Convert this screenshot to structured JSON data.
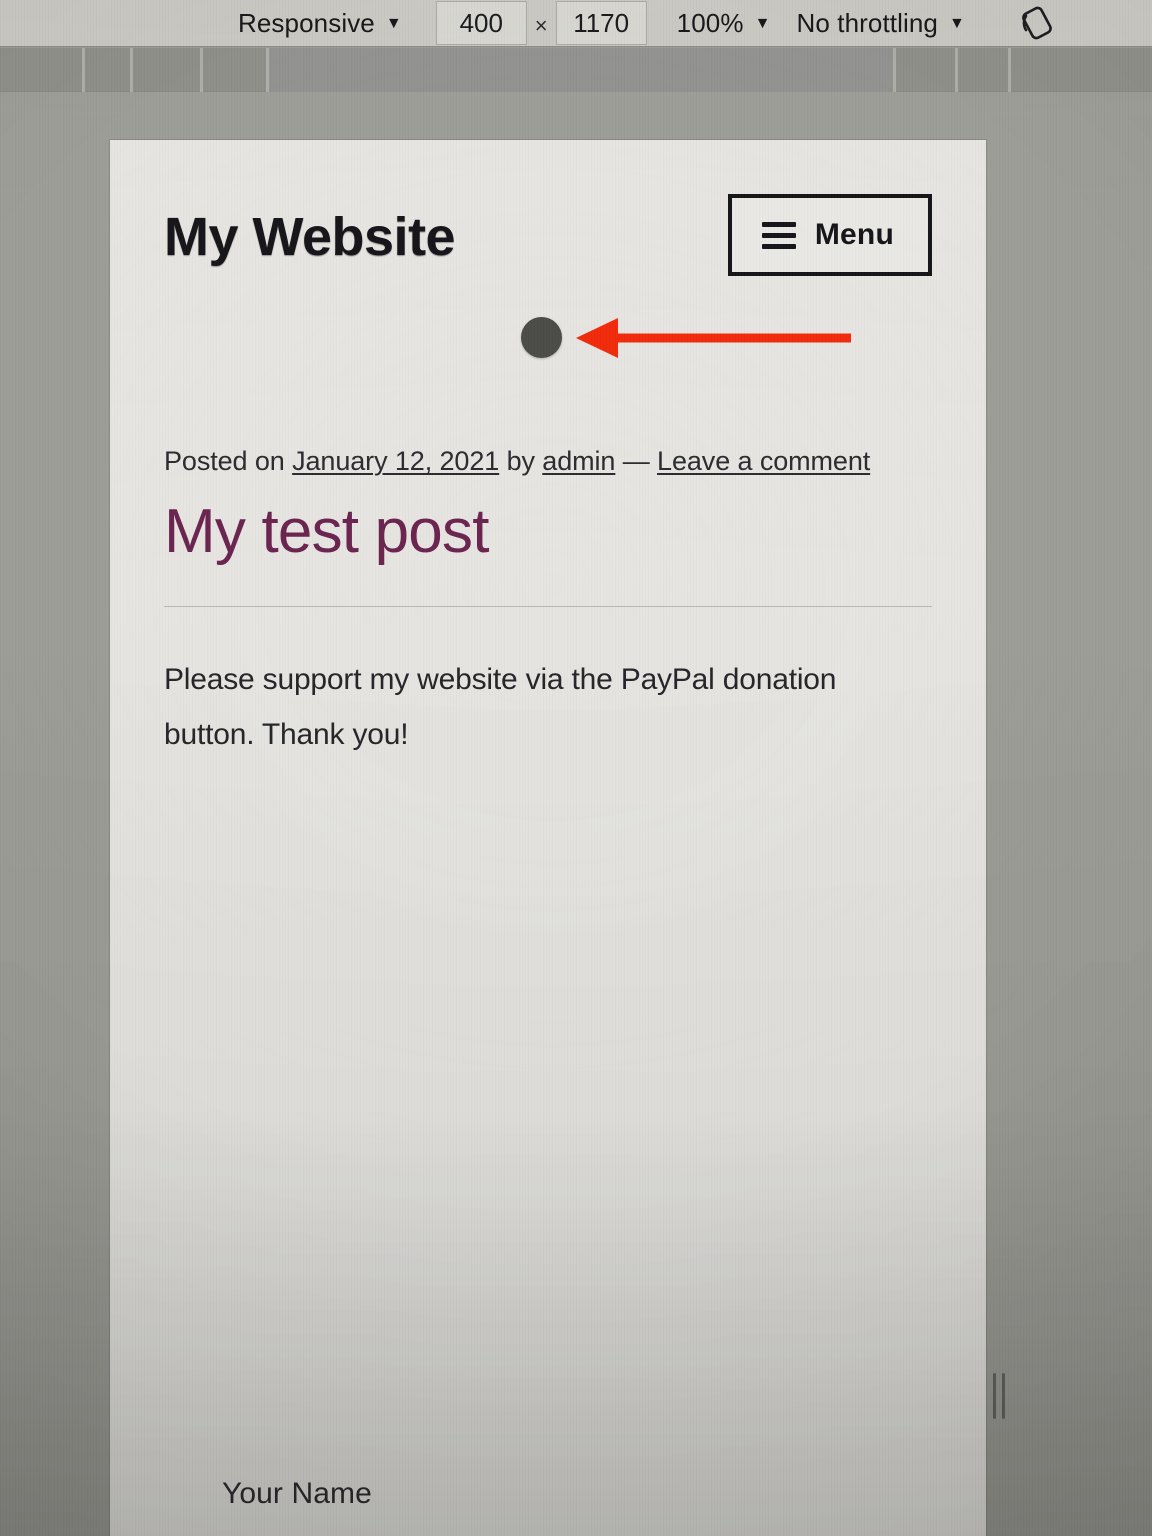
{
  "devtools": {
    "device_select": {
      "label": "Responsive",
      "caret": "▼",
      "icon": "chevron-down-icon"
    },
    "width_field": {
      "value": "400"
    },
    "separator": "×",
    "height_field": {
      "value": "1170"
    },
    "zoom_select": {
      "label": "100%",
      "caret": "▼"
    },
    "throttling_select": {
      "label": "No throttling",
      "caret": "▼"
    },
    "rotate_button": {
      "icon": "rotate-device-icon",
      "title": "Rotate"
    }
  },
  "ruler": {
    "ticks": [
      82,
      130,
      200,
      266,
      893,
      955,
      1008
    ]
  },
  "site": {
    "title": "My Website",
    "menu_button": {
      "label": "Menu",
      "icon": "hamburger-icon"
    }
  },
  "annotation": {
    "arrow": {
      "color": "#f22b0c",
      "direction": "left",
      "points_to": "paypal-donate-button"
    },
    "blob": {
      "color": "#4b4b47",
      "shape": "circle"
    }
  },
  "post": {
    "meta": {
      "posted_on_prefix": "Posted on ",
      "date": "January 12, 2021",
      "by_prefix": " by ",
      "author": "admin",
      "dash": " — ",
      "comment_link": "Leave a comment"
    },
    "title": "My test post",
    "title_color": "#6b2450",
    "body": "Please support my website via the PayPal donation button. Thank you!"
  },
  "comment_form": {
    "name_label": "Your Name"
  },
  "colors": {
    "toolbar_bg": "#c9c8c2",
    "canvas_bg": "#9d9d97",
    "viewport_bg": "#e6e5e1",
    "accent_red": "#f22b0c",
    "link_color": "#2c2c30"
  }
}
